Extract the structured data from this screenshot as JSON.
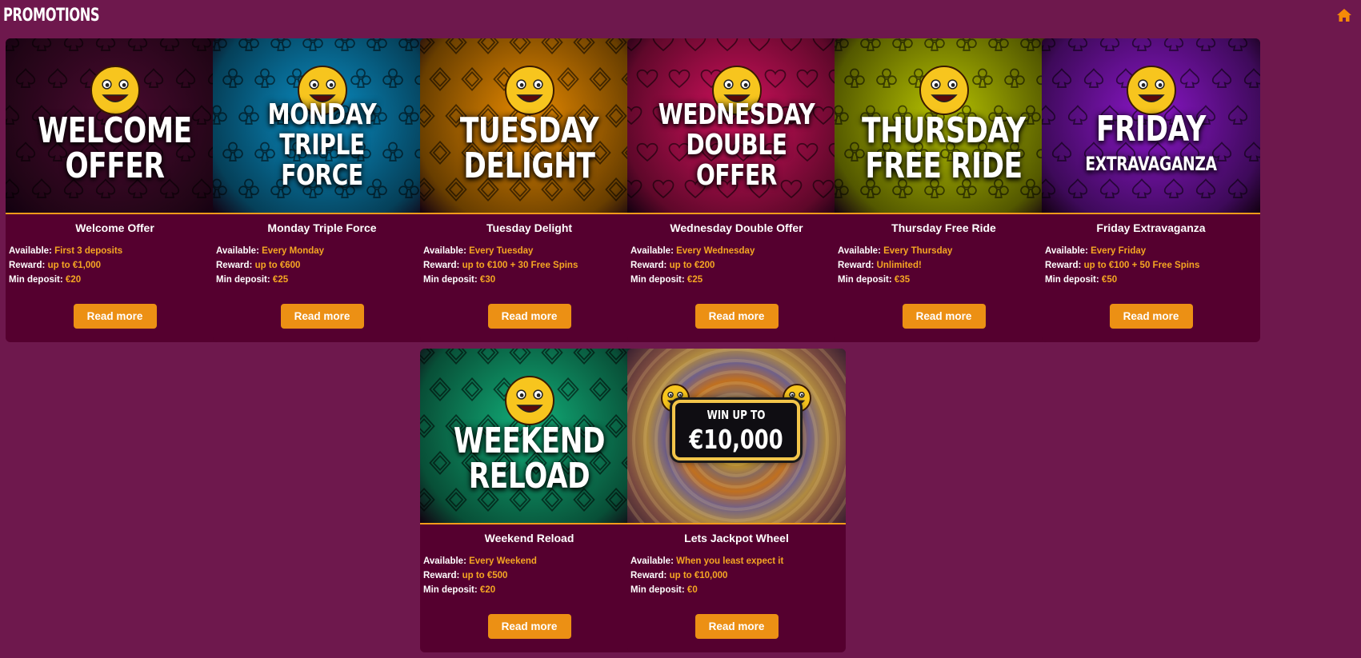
{
  "header": {
    "title": "PROMOTIONS",
    "home_icon": "home-icon"
  },
  "labels": {
    "available": "Available:",
    "reward": "Reward:",
    "min_deposit": "Min deposit:"
  },
  "colors": {
    "background": "#6e184d",
    "card": "#55002f",
    "accent": "#f39b1a",
    "button": "#ec9014"
  },
  "promotions": [
    {
      "name": "Welcome Offer",
      "banner_lines": [
        "WELCOME",
        "OFFER"
      ],
      "available": "First 3 deposits",
      "reward": "up to €1,000",
      "min_deposit": "€20",
      "button": "Read more",
      "theme": "#4a0a30",
      "suit": "spade"
    },
    {
      "name": "Monday Triple Force",
      "banner_lines": [
        "MONDAY",
        "TRIPLE",
        "FORCE"
      ],
      "available": "Every Monday",
      "reward": "up to €600",
      "min_deposit": "€25",
      "button": "Read more",
      "theme": "#0a8fc6",
      "suit": "club"
    },
    {
      "name": "Tuesday Delight",
      "banner_lines": [
        "TUESDAY",
        "DELIGHT"
      ],
      "available": "Every Tuesday",
      "reward": "up to €100 + 30 Free Spins",
      "min_deposit": "€30",
      "button": "Read more",
      "theme": "#e88a00",
      "suit": "diamond"
    },
    {
      "name": "Wednesday Double Offer",
      "banner_lines": [
        "WEDNESDAY",
        "DOUBLE",
        "OFFER"
      ],
      "available": "Every Wednesday",
      "reward": "up to €200",
      "min_deposit": "€25",
      "button": "Read more",
      "theme": "#d4115e",
      "suit": "heart"
    },
    {
      "name": "Thursday Free Ride",
      "banner_lines": [
        "THURSDAY",
        "FREE RIDE"
      ],
      "available": "Every Thursday",
      "reward": "Unlimited!",
      "min_deposit": "€35",
      "button": "Read more",
      "theme": "#b8c400",
      "suit": "club"
    },
    {
      "name": "Friday Extravaganza",
      "banner_lines": [
        "FRIDAY",
        "EXTRAVAGANZA"
      ],
      "available": "Every Friday",
      "reward": "up to €100 + 50 Free Spins",
      "min_deposit": "€50",
      "button": "Read more",
      "theme": "#8a16c8",
      "suit": "spade"
    },
    {
      "name": "Weekend Reload",
      "banner_lines": [
        "WEEKEND",
        "RELOAD"
      ],
      "available": "Every Weekend",
      "reward": "up to €500",
      "min_deposit": "€20",
      "button": "Read more",
      "theme": "#12b07a",
      "suit": "diamond"
    },
    {
      "name": "Lets Jackpot Wheel",
      "banner_lines": [
        "WIN UP TO",
        "€10,000"
      ],
      "available": "When you least expect it",
      "reward": "up to €10,000",
      "min_deposit": "€0",
      "button": "Read more",
      "theme": "#7a5a3a",
      "suit": "wheel"
    }
  ]
}
